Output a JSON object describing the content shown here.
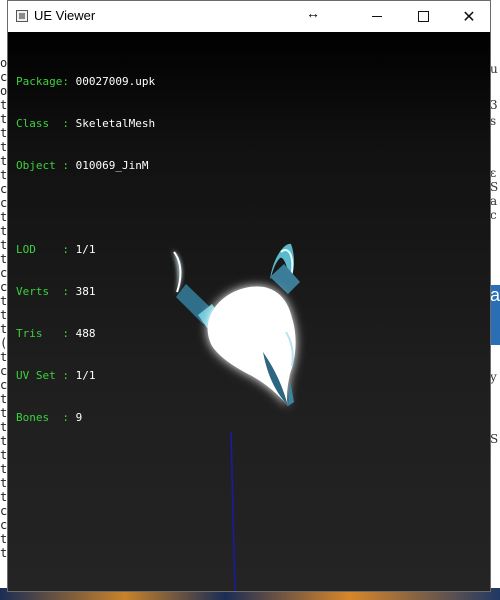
{
  "window": {
    "title": "UE Viewer",
    "icon": "app-icon",
    "controls": {
      "minimize": "minimize-icon",
      "maximize": "maximize-icon",
      "close": "close-icon"
    }
  },
  "info": {
    "package": {
      "key": "Package",
      "sep": ": ",
      "value": "00027009.upk"
    },
    "class": {
      "key": "Class  ",
      "sep": ": ",
      "value": "SkeletalMesh"
    },
    "object": {
      "key": "Object ",
      "sep": ": ",
      "value": "010069_JinM"
    },
    "lod": {
      "key": "LOD    ",
      "sep": ": ",
      "value": "1/1"
    },
    "verts": {
      "key": "Verts  ",
      "sep": ": ",
      "value": "381"
    },
    "tris": {
      "key": "Tris   ",
      "sep": ": ",
      "value": "488"
    },
    "uvset": {
      "key": "UV Set ",
      "sep": ": ",
      "value": "1/1"
    },
    "bones": {
      "key": "Bones  ",
      "sep": ": ",
      "value": "9"
    }
  },
  "colors": {
    "label_green": "#3ed13e",
    "value_white": "#ffffff",
    "axis_blue": "#1a1aa8",
    "mesh_glow": "#ffffff",
    "mesh_cyan": "#7fe3f2"
  },
  "background": {
    "left_chars": "ocottttttccttttccttt(tccttttttttcctt",
    "right_fragments": [
      "u",
      "3",
      "s",
      "ε",
      "S",
      "a",
      "c",
      "a",
      "y",
      "S"
    ]
  }
}
